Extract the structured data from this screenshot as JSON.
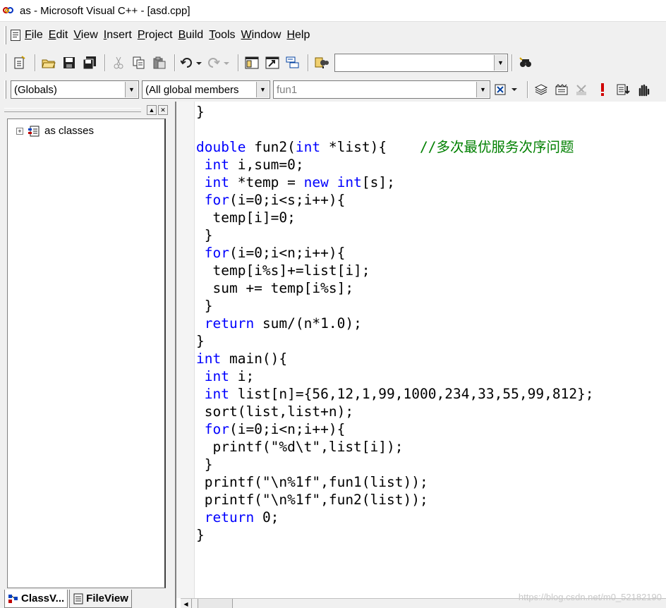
{
  "window": {
    "title": "as - Microsoft Visual C++ - [asd.cpp]"
  },
  "menu": [
    {
      "label": "File",
      "underline": "F",
      "rest": "ile"
    },
    {
      "label": "Edit",
      "underline": "E",
      "rest": "dit"
    },
    {
      "label": "View",
      "underline": "V",
      "rest": "iew"
    },
    {
      "label": "Insert",
      "underline": "I",
      "rest": "nsert"
    },
    {
      "label": "Project",
      "underline": "P",
      "rest": "roject"
    },
    {
      "label": "Build",
      "underline": "B",
      "rest": "uild"
    },
    {
      "label": "Tools",
      "underline": "T",
      "rest": "ools"
    },
    {
      "label": "Window",
      "underline": "W",
      "rest": "indow"
    },
    {
      "label": "Help",
      "underline": "H",
      "rest": "elp"
    }
  ],
  "toolbar": {
    "find_combo_value": "",
    "scope_combo": "(Globals)",
    "members_combo": "(All global members",
    "function_combo": "fun1"
  },
  "icons": [
    "new-document-icon",
    "open-folder-icon",
    "save-icon",
    "save-all-icon",
    "cut-icon",
    "copy-icon",
    "paste-icon",
    "undo-icon",
    "redo-icon",
    "workspace-icon",
    "output-icon",
    "window-list-icon",
    "find-in-files-icon",
    "find-icon",
    "wizard-bar-icon",
    "compile-icon",
    "build-icon",
    "stop-build-icon",
    "execute-icon",
    "go-icon",
    "insert-breakpoint-icon"
  ],
  "class_view": {
    "root_label": "as classes"
  },
  "tabs": {
    "class_view": "ClassV...",
    "file_view": "FileView"
  },
  "code_lines": [
    [
      {
        "t": "}",
        "c": ""
      }
    ],
    [
      {
        "t": "",
        "c": ""
      }
    ],
    [
      {
        "t": "double",
        "c": "kw"
      },
      {
        "t": " fun2(",
        "c": ""
      },
      {
        "t": "int",
        "c": "kw"
      },
      {
        "t": " *list){    ",
        "c": ""
      },
      {
        "t": "//多次最优服务次序问题",
        "c": "cm"
      }
    ],
    [
      {
        "t": " ",
        "c": ""
      },
      {
        "t": "int",
        "c": "kw"
      },
      {
        "t": " i,sum=0;",
        "c": ""
      }
    ],
    [
      {
        "t": " ",
        "c": ""
      },
      {
        "t": "int",
        "c": "kw"
      },
      {
        "t": " *temp = ",
        "c": ""
      },
      {
        "t": "new",
        "c": "kw"
      },
      {
        "t": " ",
        "c": ""
      },
      {
        "t": "int",
        "c": "kw"
      },
      {
        "t": "[s];",
        "c": ""
      }
    ],
    [
      {
        "t": " ",
        "c": ""
      },
      {
        "t": "for",
        "c": "kw"
      },
      {
        "t": "(i=0;i<s;i++){",
        "c": ""
      }
    ],
    [
      {
        "t": "  temp[i]=0;",
        "c": ""
      }
    ],
    [
      {
        "t": " }",
        "c": ""
      }
    ],
    [
      {
        "t": " ",
        "c": ""
      },
      {
        "t": "for",
        "c": "kw"
      },
      {
        "t": "(i=0;i<n;i++){",
        "c": ""
      }
    ],
    [
      {
        "t": "  temp[i%s]+=list[i];",
        "c": ""
      }
    ],
    [
      {
        "t": "  sum += temp[i%s];",
        "c": ""
      }
    ],
    [
      {
        "t": " }",
        "c": ""
      }
    ],
    [
      {
        "t": " ",
        "c": ""
      },
      {
        "t": "return",
        "c": "kw"
      },
      {
        "t": " sum/(n*1.0);",
        "c": ""
      }
    ],
    [
      {
        "t": "}",
        "c": ""
      }
    ],
    [
      {
        "t": "int",
        "c": "kw"
      },
      {
        "t": " main(){",
        "c": ""
      }
    ],
    [
      {
        "t": " ",
        "c": ""
      },
      {
        "t": "int",
        "c": "kw"
      },
      {
        "t": " i;",
        "c": ""
      }
    ],
    [
      {
        "t": " ",
        "c": ""
      },
      {
        "t": "int",
        "c": "kw"
      },
      {
        "t": " list[n]={56,12,1,99,1000,234,33,55,99,812};",
        "c": ""
      }
    ],
    [
      {
        "t": " sort(list,list+n);",
        "c": ""
      }
    ],
    [
      {
        "t": " ",
        "c": ""
      },
      {
        "t": "for",
        "c": "kw"
      },
      {
        "t": "(i=0;i<n;i++){",
        "c": ""
      }
    ],
    [
      {
        "t": "  printf(\"%d\\t\",list[i]);",
        "c": ""
      }
    ],
    [
      {
        "t": " }",
        "c": ""
      }
    ],
    [
      {
        "t": " printf(\"\\n%1f\",fun1(list));",
        "c": ""
      }
    ],
    [
      {
        "t": " printf(\"\\n%1f\",fun2(list));",
        "c": ""
      }
    ],
    [
      {
        "t": " ",
        "c": ""
      },
      {
        "t": "return",
        "c": "kw"
      },
      {
        "t": " 0;",
        "c": ""
      }
    ],
    [
      {
        "t": "}",
        "c": ""
      }
    ]
  ],
  "watermark": "https://blog.csdn.net/m0_52182190",
  "colors": {
    "keyword": "#0000ff",
    "comment": "#008000",
    "chrome": "#f0f0f0"
  }
}
